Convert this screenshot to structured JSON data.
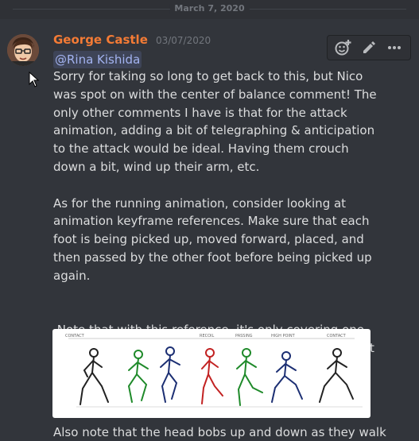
{
  "divider": {
    "date": "March 7, 2020"
  },
  "message": {
    "author": "George Castle",
    "timestamp": "03/07/2020",
    "mention": "@Rina Kishida",
    "paragraphs": [
      "Sorry for taking so long to get back to this, but Nico was spot on with the center of balance comment! The only other comments I have is that for the attack animation, adding a bit of telegraphing & anticipation to the attack would be ideal. Having them crouch down a bit, wind up their arm, etc.",
      "As for the running animation, consider looking at animation keyframe references. Make sure that each foot is being picked up, moved forward, placed, and then passed by the other foot before being picked up again.",
      " Note that with this reference, it's only covering one half of the loop, and you'd need to repeat it again but with the legs switched."
    ],
    "after_image_text": "Also note that the head bobs up and down as they walk",
    "reference_labels": [
      "CONTACT",
      "RECOIL",
      "PASSING",
      "HIGH POINT",
      "CONTACT"
    ],
    "reference_icons": [
      "running-figure-black",
      "running-figure-green",
      "running-figure-navy",
      "running-figure-red",
      "running-figure-green",
      "running-figure-navy",
      "running-figure-black"
    ]
  },
  "toolbar": {
    "icons": [
      "add-reaction-icon",
      "edit-icon",
      "more-options-icon"
    ]
  },
  "colors": {
    "background": "#2f3136",
    "message_hover": "#32353b",
    "username": "#f47b35",
    "mention": "#a3b3f0"
  }
}
